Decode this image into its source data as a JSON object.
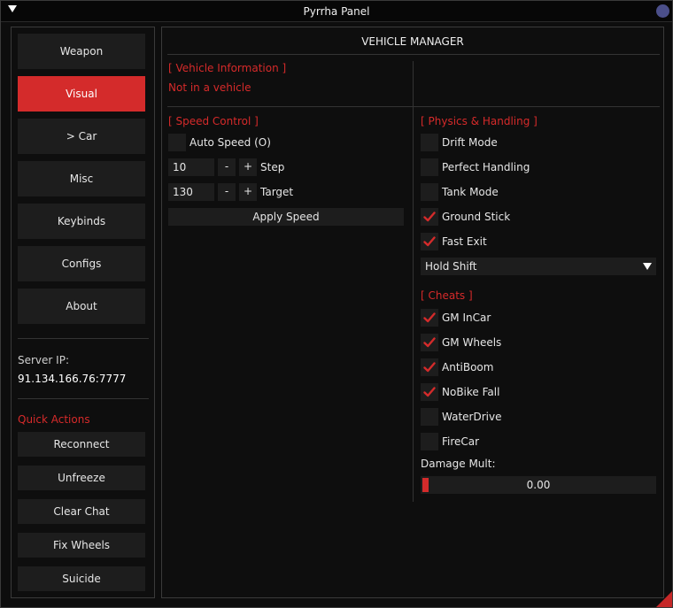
{
  "window": {
    "title": "Pyrrha Panel"
  },
  "sidebar": {
    "nav": [
      "Weapon",
      "Visual",
      "> Car",
      "Misc",
      "Keybinds",
      "Configs",
      "About"
    ],
    "active_index": 1,
    "server_ip_label": "Server IP:",
    "server_ip": "91.134.166.76:7777",
    "quick_actions_heading": "Quick Actions",
    "quick_actions": [
      "Reconnect",
      "Unfreeze",
      "Clear Chat",
      "Fix Wheels",
      "Suicide"
    ]
  },
  "main": {
    "title": "VEHICLE MANAGER",
    "vehicle_info": {
      "heading": "[ Vehicle Information ]",
      "status": "Not in a vehicle"
    },
    "speed_control": {
      "heading": "[ Speed Control ]",
      "auto_speed_label": "Auto Speed (O)",
      "auto_speed_checked": false,
      "step_value": "10",
      "step_label": "Step",
      "target_value": "130",
      "target_label": "Target",
      "minus": "-",
      "plus": "+",
      "apply_label": "Apply Speed"
    },
    "physics": {
      "heading": "[ Physics & Handling ]",
      "items": [
        {
          "label": "Drift Mode",
          "checked": false
        },
        {
          "label": "Perfect Handling",
          "checked": false
        },
        {
          "label": "Tank Mode",
          "checked": false
        },
        {
          "label": "Ground Stick",
          "checked": true
        },
        {
          "label": "Fast Exit",
          "checked": true
        }
      ],
      "exit_key_value": "Hold Shift"
    },
    "cheats": {
      "heading": "[ Cheats ]",
      "items": [
        {
          "label": "GM InCar",
          "checked": true
        },
        {
          "label": "GM Wheels",
          "checked": true
        },
        {
          "label": "AntiBoom",
          "checked": true
        },
        {
          "label": "NoBike Fall",
          "checked": true
        },
        {
          "label": "WaterDrive",
          "checked": false
        },
        {
          "label": "FireCar",
          "checked": false
        }
      ],
      "damage_mult_label": "Damage Mult:",
      "damage_mult_value": "0.00"
    }
  },
  "colors": {
    "accent": "#d42b2b",
    "accent_text": "#d62a2a",
    "panel_bg": "#0e0e0e",
    "widget_bg": "#1d1d1d"
  }
}
